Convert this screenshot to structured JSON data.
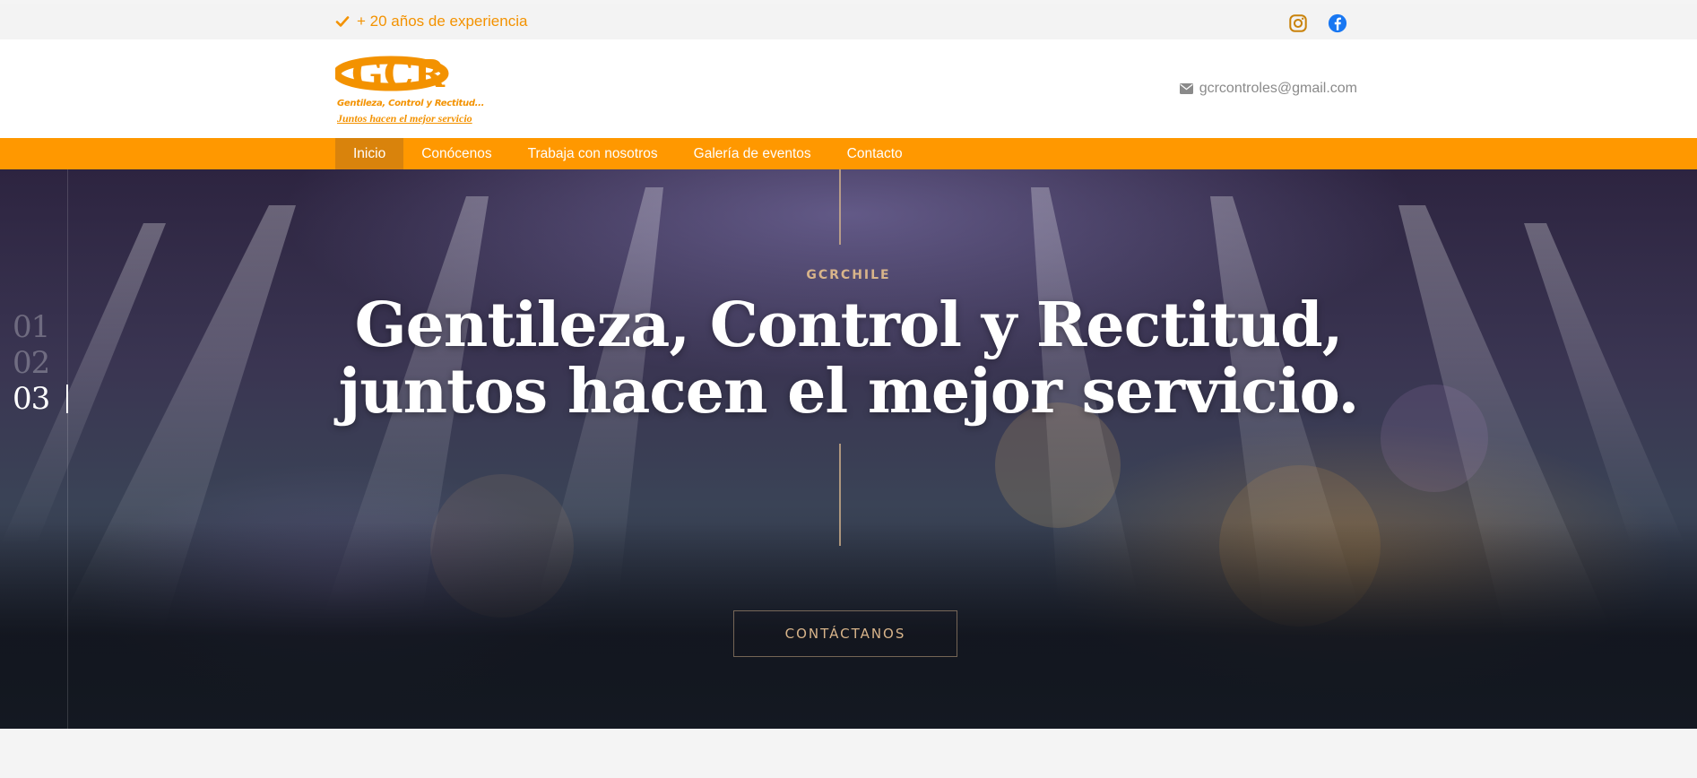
{
  "topbar": {
    "experience": "+ 20 años de experiencia",
    "instagram_icon": "instagram-icon",
    "facebook_icon": "facebook-icon"
  },
  "header": {
    "logo_letters": "GCR",
    "logo_tagline_1": "Gentileza, Control y Rectitud...",
    "logo_tagline_2": "Juntos hacen el mejor servicio",
    "email": "gcrcontroles@gmail.com"
  },
  "nav": {
    "items": [
      "Inicio",
      "Conócenos",
      "Trabaja con nosotros",
      "Galería de eventos",
      "Contacto"
    ],
    "active": "Inicio"
  },
  "hero": {
    "slides": [
      "01",
      "02",
      "03"
    ],
    "current_slide": "03",
    "kicker": "GCRCHILE",
    "headline_line1": "Gentileza, Control y Rectitud,",
    "headline_line2": "juntos hacen el mejor servicio.",
    "cta": "CONTÁCTANOS"
  },
  "colors": {
    "accent": "#ff9800",
    "accent_text": "#f39200",
    "nav_active": "#d9830c",
    "hero_gold": "#d8b48a"
  }
}
